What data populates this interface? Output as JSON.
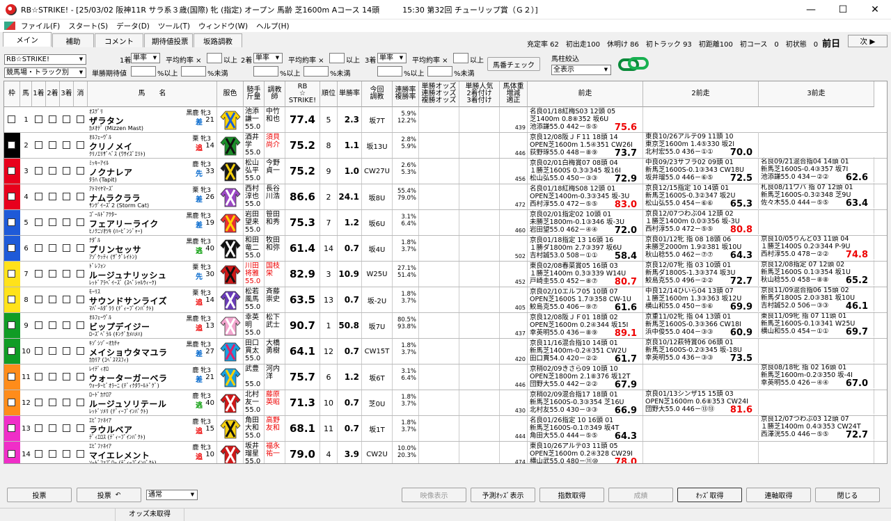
{
  "window": {
    "title": "RB☆STRIKE! - [25/03/02 阪神11R サラ系３歳(国際) 牝 (指定) オープン 馬齢 芝1600m Aコース 14頭　　　15:30 第32回 チューリップ賞（Ｇ２）]",
    "minimize": "—",
    "maximize": "☐",
    "close": "✕"
  },
  "menu": [
    "ファイル(F)",
    "スタート(S)",
    "データ(D)",
    "ツール(T)",
    "ウィンドウ(W)",
    "ヘルプ(H)"
  ],
  "tabs": [
    "メイン",
    "補助",
    "コメント",
    "期待値投票",
    "坂路調教"
  ],
  "info": {
    "text": "充定率 62　初出走100　休明け 86　初トラック 93　初距離100　初コース　0　初状態　0",
    "day": "前日"
  },
  "next_button": "次 ▶",
  "controls": {
    "profile": "RB☆STRIKE!",
    "profile2": "競馬場・トラック別",
    "place1": "1着",
    "place2": "2着",
    "place3": "3着",
    "sel_single": "単率",
    "avg_rate": "平均約率 ×",
    "above": "以上",
    "win_expect": "単勝期待値",
    "pct_above": "%以上",
    "pct_below": "%未満",
    "horse_check": "馬番チェック",
    "filter_label": "馬柱絞込",
    "filter_value": "全表示"
  },
  "headers": {
    "waku": "枠",
    "umaban": "馬",
    "p1": "1着",
    "p2": "2着",
    "p3": "3着",
    "kesu": "消",
    "horse": "馬　　名",
    "color": "服色",
    "jockey": "騎手\n斤量",
    "trainer": "調教\n師",
    "rb": "RB\n☆\nSTRIKE!",
    "rank": "順位",
    "winrate": "単勝率",
    "training": "今回\n調教",
    "rates": "連勝率\n複勝率",
    "odds": "単勝オッズ\n連勝オッズ\n複勝オッズ",
    "pop": "単勝人気\n2着付け\n3着付け",
    "weight": "馬体重\n増減\n適正",
    "prev1": "前走",
    "prev2": "2前走",
    "prev3": "3前走"
  },
  "rows": [
    {
      "waku": 1,
      "color": "#ffffff",
      "num": 1,
      "sire": "ｵｽｸﾞﾘ",
      "sex": "黒鹿 牝3",
      "name": "ザラタン",
      "dam": "ｶﾒｵﾃﾞ (Mizzen Mast)",
      "style": "差",
      "style_c": "blue",
      "sn": "21",
      "jockey": "池添\n謙一\n55.0",
      "jc": "",
      "trainer": "中竹\n和也",
      "tc": "",
      "rb": "77.4",
      "rank": "5",
      "wr": "2.3",
      "tr": "坂7T",
      "r1": "5.9%",
      "r2": "12.2%",
      "wt": "439",
      "silk": [
        "#ffd200",
        "#1a5fd6"
      ],
      "p": [
        [
          "名良01/18紅梅S03 12頭 05",
          "芝1400m 0.8⑧352 坂6U",
          "池添謙55.0 442－⑤⑤",
          "75.6",
          "05",
          "red"
        ],
        [
          "東良10/26アルテ09 11頭 10",
          "東京芝1600m 1.4⑤330 坂2I",
          "北村宏55.0 436－①① ",
          "70.0",
          "10",
          ""
        ],
        [
          "名良09/21混合指04 14頭 01",
          "新馬芝1600S-0.4③357 坂7I",
          "池添謙55.0 434－②② ",
          "62.6",
          "01",
          ""
        ]
      ]
    },
    {
      "waku": 2,
      "color": "#000000",
      "num": 2,
      "sire": "ｵﾙﾌｪｰｳﾞﾙ",
      "sex": "栗 牝3",
      "name": "クリノメイ",
      "dam": "ｸﾘﾉｴﾘｻﾞﾍﾞｽ (ﾜｻｲｽﾞｴﾘﾄ)",
      "style": "追",
      "style_c": "red",
      "sn": "14",
      "jockey": "酒井\n学\n55.0",
      "jc": "",
      "trainer": "須貝\n尚介",
      "tc": "red",
      "rb": "75.2",
      "rank": "8",
      "wr": "1.1",
      "tr": "坂13U",
      "r1": "2.8%",
      "r2": "5.9%",
      "wt": "446",
      "silk": [
        "#1c8f2a",
        "#111"
      ],
      "p": [
        [
          "京良12/08阪ＪＦ11 18頭 14",
          "OPEN芝1600m 1.5④351 CW26I",
          "荻野琢55.0 448－⑧⑨",
          "73.7",
          "14",
          ""
        ],
        [
          "中良09/23サフラ02 09頭 01",
          "新馬芝1600S-0.1③343 CW18U",
          "坂井瑠55.0 446－⑥⑤",
          "72.5",
          "01",
          ""
        ],
        [
          "札良08/11ワバ 指 07 12頭 01",
          "新馬芝1600S-0.3②348 芝9U",
          "佐々木55.0 444－⑤⑤",
          "63.4",
          "01",
          ""
        ]
      ]
    },
    {
      "waku": 3,
      "color": "#e8001c",
      "num": 3,
      "sire": "ﾐｯｷｰｱｲﾙ",
      "sex": "鹿 牝3",
      "name": "ノクナレア",
      "dam": "ﾀﾗﾊ (Tapit)",
      "style": "先",
      "style_c": "blue",
      "sn": "33",
      "jockey": "松山\n弘平\n55.0",
      "jc": "",
      "trainer": "今野\n貞一",
      "tc": "",
      "rb": "75.2",
      "rank": "9",
      "wr": "1.0",
      "tr": "CW27U",
      "r1": "2.6%",
      "r2": "5.3%",
      "wt": "456",
      "silk": [
        "#1a1a1a",
        "#f7d10e"
      ],
      "p": [
        [
          "京良02/01白梅賞07 08頭 04",
          "１勝芝1600S 0.3③345 坂16I",
          "松山弘55.0 450－③③",
          "72.9",
          "04",
          ""
        ],
        [
          "京良12/15指定 10 14頭 01",
          "新馬芝1600S-0.3②347 坂2U",
          "松山弘55.0 454－⑥⑥",
          "65.3",
          "01",
          ""
        ],
        [
          "",
          "",
          "",
          "",
          "",
          ""
        ]
      ]
    },
    {
      "waku": 3,
      "color": "#e8001c",
      "num": 4,
      "sire": "ｱﾄﾏｲﾔﾏｰｽﾞ",
      "sex": "栗 牝3",
      "name": "ナムラクララ",
      "dam": "ｻﾝｸﾞｲｰｽﾞ2 (Storm Cat)",
      "style": "差",
      "style_c": "blue",
      "sn": "26",
      "jockey": "西村\n淳也\n55.0",
      "jc": "",
      "trainer": "長谷\n川浩",
      "tc": "",
      "rb": "86.6",
      "rank": "2",
      "wr": "24.1",
      "tr": "坂8U",
      "r1": "55.4%",
      "r2": "79.0%",
      "wt": "472",
      "silk": [
        "#9b49c4",
        "#fff"
      ],
      "p": [
        [
          "名良01/18紅梅S08 12頭 01",
          "OPEN芝1400m-0.3③345 坂-3U",
          "西村淳55.0 472－⑤⑤",
          "83.0",
          "01",
          "red"
        ],
        [
          "京良12/07つわぶ04 12頭 02",
          "１勝芝1400m 0.0③356 坂-3U",
          "西村淳55.0 472－⑤⑤",
          "80.8",
          "02",
          "red"
        ],
        [
          "京良10/05りんど03 11頭 04",
          "１勝芝1400S 0.2③344 P-9U",
          "西村淳55.0 478－②②",
          "74.8",
          "04",
          "red"
        ]
      ]
    },
    {
      "waku": 4,
      "color": "#1e5ad8",
      "num": 5,
      "sire": "ｺﾞｰﾙﾄﾞｱｸﾀｰ",
      "sex": "黒鹿 牝3",
      "name": "フェアリーライク",
      "dam": "ﾋﾉｸﾆｿｵﾂｷ (ﾊｰﾋﾞﾝｼﾞｬｰ)",
      "style": "差",
      "style_c": "blue",
      "sn": "19",
      "jockey": "岩田\n望来\n55.0",
      "jc": "",
      "trainer": "笹田\n和秀",
      "tc": "",
      "rb": "75.3",
      "rank": "7",
      "wr": "1.2",
      "tr": "坂6U",
      "r1": "3.1%",
      "r2": "6.4%",
      "wt": "460",
      "silk": [
        "#e83030",
        "#ffd200"
      ],
      "p": [
        [
          "京良02/01指定02 10頭 01",
          "未勝芝1800m-0.1③346 坂-3U",
          "岩田望55.0 462－④④",
          "72.0",
          "01",
          ""
        ],
        [
          "京良01/12牝 指 08 18頭 06",
          "未勝芝2000m 1.9②381 坂10U",
          "秋山稔55.0 462－⑦⑦",
          "64.3",
          "06",
          ""
        ],
        [
          "京良12/08指定 07 12頭 02",
          "新馬芝1600S 0.1③354 坂1U",
          "秋山稔55.0 458－⑧⑧",
          "65.2",
          "02",
          ""
        ]
      ]
    },
    {
      "waku": 4,
      "color": "#1e5ad8",
      "num": 6,
      "sire": "ﾅﾀﾞﾙ",
      "sex": "黒鹿 牝3",
      "name": "プリンセッサ",
      "dam": "ｱｿﾞｹｯﾃｨ (ｻﾞｸﾞﾚｲﾄﾝ)",
      "style": "逃",
      "style_c": "green",
      "sn": "40",
      "jockey": "和田\n竜二\n55.0",
      "jc": "",
      "trainer": "牧田\n和弥",
      "tc": "",
      "rb": "61.4",
      "rank": "14",
      "wr": "0.7",
      "tr": "坂4U",
      "r1": "1.8%",
      "r2": "3.7%",
      "wt": "502",
      "silk": [
        "#111",
        "#fff"
      ],
      "p": [
        [
          "京良01/18指定 13 16頭 16",
          "１勝ダ1800m 2.7③397 坂6U",
          "吉村誠53.0 508－①①",
          "58.4",
          "16",
          ""
        ],
        [
          "京良12/07牝 指 03 10頭 01",
          "新馬ダ1800S-1.3③374 坂3U",
          "鮫島克55.0 496－②②",
          "72.7",
          "01",
          ""
        ],
        [
          "京良11/09混合指06 15頭 02",
          "新馬ダ1800S 2.0③381 坂10U",
          "吉村誠52.0 506－③③",
          "46.1",
          "02",
          ""
        ]
      ]
    },
    {
      "waku": 5,
      "color": "#ffe21a",
      "num": 7,
      "sire": "ﾄﾞﾚﾌｫﾝ",
      "sex": "栗 牝3",
      "name": "ルージュナリッシュ",
      "dam": "ﾚｯﾄﾞｱﾗﾍﾞｲｰｽﾞ (ｽﾍﾟｼｬﾙｳｨｰｸ)",
      "style": "先",
      "style_c": "blue",
      "sn": "30",
      "jockey": "川田\n将雅\n55.0",
      "jc": "red",
      "trainer": "国枝\n栄",
      "tc": "red",
      "rb": "82.9",
      "rank": "3",
      "wr": "10.9",
      "tr": "W25U",
      "r1": "27.1%",
      "r2": "51.4%",
      "wt": "452",
      "silk": [
        "#d01818",
        "#111"
      ],
      "p": [
        [
          "東良02/08春菜賞05 16頭 03",
          "１勝芝1400m 0.3③339 W14U",
          "戸崎圭55.0 452－⑧⑦",
          "80.7",
          "03",
          "red"
        ],
        [
          "中良12/14ひいら04 13頭 07",
          "１勝芝1600m 1.3③363 坂12U",
          "横山和55.0 450－⑤⑥",
          "69.9",
          "07",
          ""
        ],
        [
          "東良11/09牝 指 07 11頭 01",
          "新馬芝1600S-0.1③341 W25U",
          "横山和55.0 454－①①",
          "69.7",
          "01",
          ""
        ]
      ]
    },
    {
      "waku": 5,
      "color": "#ffe21a",
      "num": 8,
      "sire": "ﾓｰﾘｽ",
      "sex": "栗 牝3",
      "name": "サウンドサンライズ",
      "dam": "ﾏﾊﾞｰﾙﾀﾞﾗﾗ (ﾃﾞｨｰﾌﾟｲﾝﾊﾟｸﾄ)",
      "style": "追",
      "style_c": "red",
      "sn": "14",
      "jockey": "松若\n風馬\n55.0",
      "jc": "",
      "trainer": "斉藤\n崇史",
      "tc": "",
      "rb": "63.5",
      "rank": "13",
      "wr": "0.7",
      "tr": "坂-2U",
      "r1": "1.8%",
      "r2": "3.7%",
      "wt": "405",
      "silk": [
        "#6a3cb8",
        "#fff"
      ],
      "p": [
        [
          "京良02/10エルフ05 10頭 07",
          "OPEN芝1600S 1.7③358 CW-1U",
          "鮫島克55.0 406－⑨⑦",
          "61.6",
          "07",
          ""
        ],
        [
          "京重11/02牝 指 04 13頭 01",
          "新馬芝1600S-0.3③366 CW18I",
          "浜中俊55.0 404－③③",
          "60.9",
          "01",
          ""
        ],
        [
          "",
          "",
          "",
          "",
          "",
          ""
        ]
      ]
    },
    {
      "waku": 6,
      "color": "#109c25",
      "num": 9,
      "sire": "ｵﾙﾌｪｰｳﾞﾙ",
      "sex": "黒鹿 牝3",
      "name": "ビップデイジー",
      "dam": "ﾛｰｽﾞﾍﾞﾗﾙ (ｷﾝｸﾞｶﾒﾊﾒﾊ)",
      "style": "追",
      "style_c": "red",
      "sn": "13",
      "jockey": "幸英\n明\n55.0",
      "jc": "",
      "trainer": "松下\n武士",
      "tc": "",
      "rb": "90.7",
      "rank": "1",
      "wr": "50.8",
      "tr": "坂7U",
      "r1": "80.5%",
      "r2": "93.8%",
      "wt": "437",
      "silk": [
        "#f3a6cf",
        "#fff"
      ],
      "p": [
        [
          "京良12/08阪ＪＦ01 18頭 02",
          "OPEN芝1600m 0.2④344 坂15I",
          "幸英明55.0 436－⑧⑨",
          "89.1",
          "02",
          "red"
        ],
        [
          "京良10/12萩特賞06 06頭 01",
          "新馬芝1600S-0.2③345 坂-18U",
          "幸英明55.0 436－③③",
          "73.5",
          "01",
          ""
        ],
        [
          "京良08/18牝 指 02 16頭 01",
          "新馬芝1600m-0.2③350 坂-4I",
          "幸英明55.0 426－④④",
          "67.0",
          "01",
          ""
        ]
      ]
    },
    {
      "waku": 6,
      "color": "#109c25",
      "num": 10,
      "sire": "ｷｿﾞｼｿﾞｰｵｶﾁｬ",
      "sex": "黒鹿 牝3",
      "name": "メイショウタマユラ",
      "dam": "ｶｶﾘｱ (ｺﾍﾞｽﾏｽﾌｨ)",
      "style": "差",
      "style_c": "blue",
      "sn": "27",
      "jockey": "田口\n貫太\n55.0",
      "jc": "",
      "trainer": "大橋\n勇樹",
      "tc": "",
      "rb": "64.1",
      "rank": "12",
      "wr": "0.7",
      "tr": "CW15T",
      "r1": "1.8%",
      "r2": "3.7%",
      "wt": "420",
      "silk": [
        "#1aa0e0",
        "#e0206b"
      ],
      "p": [
        [
          "京良11/16混合指10 14頭 01",
          "新馬芝1400m-0.2④351 CW2U",
          "田口貫54.0 420－②②",
          "61.7",
          "01",
          ""
        ],
        [
          "",
          "",
          "",
          "",
          "",
          ""
        ],
        [
          "",
          "",
          "",
          "",
          "",
          ""
        ]
      ]
    },
    {
      "waku": 7,
      "color": "#ff8c1a",
      "num": 11,
      "sire": "ﾚｲﾃﾞｨｵﾛ",
      "sex": "鹿 牝3",
      "name": "ウォーターガーベラ",
      "dam": "ｳｫｰﾀｰﾋﾞｵﾗｰﾆ (ﾃﾞｨｸﾀﾜｰﾙﾄﾞｸﾞ)",
      "style": "差",
      "style_c": "blue",
      "sn": "21",
      "jockey": "武豊\n\n55.0",
      "jc": "",
      "trainer": "河内\n洋",
      "tc": "",
      "rb": "75.7",
      "rank": "6",
      "wr": "1.2",
      "tr": "坂6T",
      "r1": "3.1%",
      "r2": "6.4%",
      "wt": "446",
      "silk": [
        "#1aa0e0",
        "#ffd200"
      ],
      "p": [
        [
          "京稍02/09きさら09 10頭 10",
          "OPEN芝1800m 2.1⑧376 坂12T",
          "団野大55.0 442－②②",
          "67.9",
          "10",
          ""
        ],
        [
          "京良01/13シンザ15 15頭 03",
          "OPEN芝1600m 0.6⑧353 CW24I",
          "団野大55.0 446－⑬⑬",
          "81.6",
          "03",
          "red"
        ],
        [
          "京良12/07つわぶ03 12頭 07",
          "１勝芝1400m 0.4③353 CW24T",
          "西澤洸55.0 446－⑤⑤",
          "72.7",
          "07",
          ""
        ]
      ]
    },
    {
      "waku": 7,
      "color": "#ff8c1a",
      "num": 12,
      "sire": "ﾛｰﾄﾞｶﾅﾛｱ",
      "sex": "鹿 牝3",
      "name": "ルージュソリテール",
      "dam": "ﾚｯﾄﾞｿﾒﾘ (ﾃﾞｨｰﾌﾟｲﾝﾊﾟｸﾄ)",
      "style": "逃",
      "style_c": "green",
      "sn": "40",
      "jockey": "北村\n友一\n55.0",
      "jc": "",
      "trainer": "藤原\n英昭",
      "tc": "red",
      "rb": "71.3",
      "rank": "10",
      "wr": "0.7",
      "tr": "芝0U",
      "r1": "1.8%",
      "r2": "3.7%",
      "wt": "430",
      "silk": [
        "#d01818",
        "#fff"
      ],
      "p": [
        [
          "京稍02/09混合指17 18頭 01",
          "新馬芝1600S-0.3③354 芝16U",
          "北村友55.0 430－③③",
          "66.9",
          "01",
          ""
        ],
        [
          "",
          "",
          "",
          "",
          "",
          ""
        ],
        [
          "",
          "",
          "",
          "",
          "",
          ""
        ]
      ]
    },
    {
      "waku": 8,
      "color": "#f02ec8",
      "num": 13,
      "sire": "ｴﾋﾟﾌｧﾈｲｱ",
      "sex": "鹿 牝3",
      "name": "ラウルベア",
      "dam": "ﾃﾞｨｴﾛｽ (ﾃﾞｨｰﾌﾟｲﾝﾊﾟｸﾄ)",
      "style": "追",
      "style_c": "red",
      "sn": "15",
      "jockey": "角田\n大和\n55.0",
      "jc": "",
      "trainer": "高野\n友和",
      "tc": "red",
      "rb": "68.1",
      "rank": "11",
      "wr": "0.7",
      "tr": "坂1T",
      "r1": "1.8%",
      "r2": "3.7%",
      "wt": "444",
      "silk": [
        "#f7d10e",
        "#111"
      ],
      "p": [
        [
          "名良01/26指定 10 16頭 01",
          "新馬芝1600S-0.1⑦349 坂4T",
          "角田大55.0 444－⑤⑤",
          "64.3",
          "01",
          ""
        ],
        [
          "",
          "",
          "",
          "",
          "",
          ""
        ],
        [
          "",
          "",
          "",
          "",
          "",
          ""
        ]
      ]
    },
    {
      "waku": 8,
      "color": "#f02ec8",
      "num": 14,
      "sire": "ｴﾋﾟﾌｧﾈｲｱ",
      "sex": "鹿 牝3",
      "name": "マイエレメント",
      "dam": "ｿｰﾄﾞﾌｧﾌﾟﾛｰ (ﾃﾞｨｰﾌﾟｲﾝﾊﾟｸﾄ)",
      "style": "追",
      "style_c": "red",
      "sn": "10",
      "jockey": "坂井\n瑠星\n55.0",
      "jc": "",
      "trainer": "福永\n祐一",
      "tc": "red",
      "rb": "79.0",
      "rank": "4",
      "wr": "3.9",
      "tr": "CW2U",
      "r1": "10.0%",
      "r2": "20.3%",
      "wt": "474",
      "silk": [
        "#d01818",
        "#fff"
      ],
      "p": [
        [
          "東良10/26アルテ03 11頭 05",
          "OPEN芝1600m 0.2④328 CW29I",
          "横山武55.0 480－⑪⑩",
          "78.0",
          "05",
          "red"
        ],
        [
          "新良08/25牝 指 10 17頭 01",
          "新馬芝1600S-0.4③333 坂19U",
          "横山武55.0 474－⑥⑥",
          "70.5",
          "01",
          ""
        ],
        [
          "",
          "",
          "",
          "",
          "",
          ""
        ]
      ]
    }
  ],
  "bottom": {
    "vote": "投票",
    "vote2": "投票",
    "mode": "通常",
    "video": "映像表示",
    "pred": "予測ｵｯｽﾞ表示",
    "index": "指数取得",
    "result": "成績",
    "odds": "ｵｯｽﾞ取得",
    "training": "連軸取得",
    "close": "閉じる"
  },
  "status": "オッズ未取得"
}
